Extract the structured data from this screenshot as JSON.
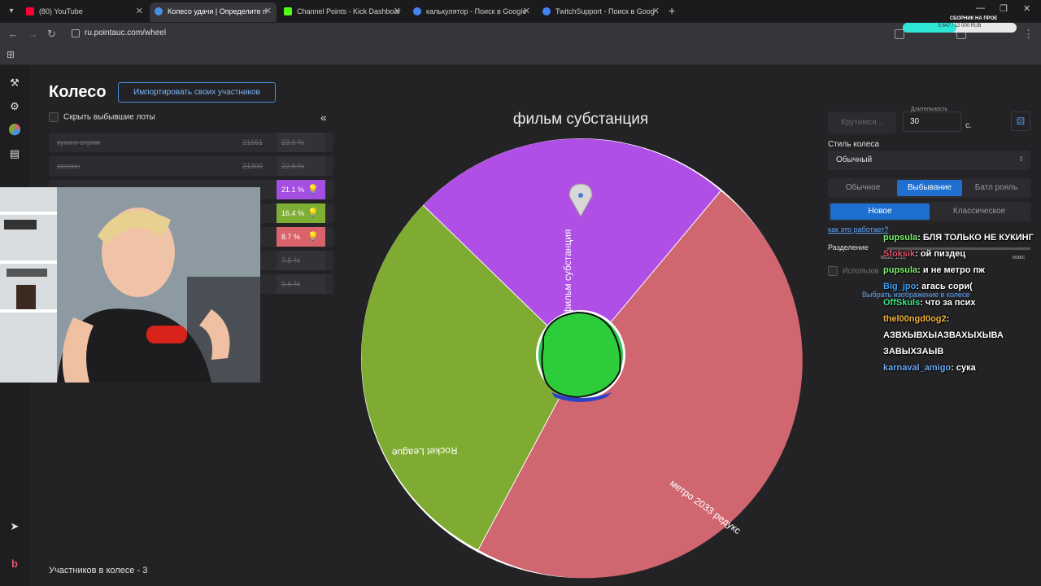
{
  "browser": {
    "tabs": [
      {
        "title": "(80) YouTube",
        "color": "#ff0033",
        "active": false
      },
      {
        "title": "Колесо удачи | Определите п",
        "color": "#4a90e2",
        "active": true
      },
      {
        "title": "Channel Points - Kick Dashboar",
        "color": "#53fc18",
        "active": false
      },
      {
        "title": "калькулятор - Поиск в Google",
        "color": "#4285f4",
        "active": false
      },
      {
        "title": "TwitchSupport - Поиск в Goog",
        "color": "#4285f4",
        "active": false
      }
    ],
    "new_tab": "+",
    "url": "ru.pointauc.com/wheel"
  },
  "donation": {
    "title": "СБОРНИК НА ПРОЕ",
    "text": "5 647 / 12 000 RUB",
    "progress": 0.47
  },
  "app": {
    "title": "Колесо",
    "import_button": "Импортировать своих участников",
    "hide_checkbox_label": "Скрыть выбывшие лоты",
    "collapse_icon": "«",
    "participants_count": "Участников в колесе - 3"
  },
  "lots": [
    {
      "name": "кукинг стрим",
      "amount": "21651",
      "percent": "23.0 %",
      "active": false,
      "color": ""
    },
    {
      "name": "всесин",
      "amount": "21300",
      "percent": "22.6 %",
      "active": false,
      "color": ""
    },
    {
      "name": "",
      "amount": "",
      "percent": "21.1 %",
      "active": true,
      "color": "#a44fe0"
    },
    {
      "name": "",
      "amount": "",
      "percent": "16.4 %",
      "active": true,
      "color": "#7fae35"
    },
    {
      "name": "",
      "amount": "",
      "percent": "8.7 %",
      "active": true,
      "color": "#d9636a"
    },
    {
      "name": "",
      "amount": "",
      "percent": "7.5 %",
      "active": false,
      "color": ""
    },
    {
      "name": "",
      "amount": "",
      "percent": "0.6 %",
      "active": false,
      "color": ""
    }
  ],
  "wheel": {
    "winner": "фильм субстанция",
    "segments": [
      {
        "label": "фильм субстанция",
        "color": "#b04fe6"
      },
      {
        "label": "метро 2033 редукс",
        "color": "#cf6670"
      },
      {
        "label": "Rocket League",
        "color": "#7fab33"
      }
    ]
  },
  "controls": {
    "spin_button": "Крутимся...",
    "duration_label": "Длительность",
    "duration_value": "30",
    "duration_unit": "с.",
    "style_label": "Стиль колеса",
    "style_value": "Обычный",
    "modes": [
      "Обычное",
      "Выбывание",
      "Батл рояль"
    ],
    "submodes": [
      "Новое",
      "Классическое"
    ],
    "how_link": "как это работает?",
    "split_label": "Разделение",
    "slider_min_label": "макс 1/10",
    "slider_max_label": "макс",
    "use_label": "Использов",
    "image_link": "Выбрать изображение в колесе"
  },
  "chat": [
    {
      "nick": "pupsula",
      "color": "#7cf26a",
      "text": "БЛЯ ТОЛЬКО НЕ КУКИНГ"
    },
    {
      "nick": "Sfoksik",
      "color": "#e2556e",
      "text": "ой пиздец"
    },
    {
      "nick": "pupsula",
      "color": "#7cf26a",
      "text": "и не метро пж"
    },
    {
      "nick": "Big_jpo",
      "color": "#3aa4f5",
      "text": "агась сори("
    },
    {
      "nick": "OffSkuls",
      "color": "#3ee68a",
      "text": "что за псих"
    },
    {
      "nick": "thel00ngd0og2",
      "color": "#f2b23a",
      "text": "АЗВХЫВХЫАЗВАХЫХЫВА ЗАВЫХЗАЫВ"
    },
    {
      "nick": "karnaval_amigo",
      "color": "#6aa8f0",
      "text": "сука"
    }
  ]
}
